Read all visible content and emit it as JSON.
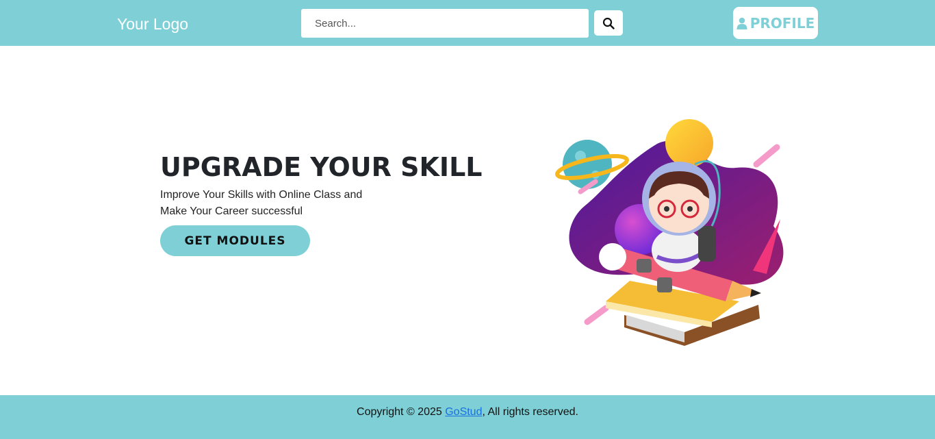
{
  "header": {
    "logo_text": "Your Logo",
    "search_placeholder": "Search...",
    "profile_label": "PROFILE"
  },
  "hero": {
    "title": "UPGRADE YOUR SKILL",
    "subtitle_line1": "Improve Your Skills with Online Class and",
    "subtitle_line2": "Make Your Career successful",
    "cta_label": "GET MODULES"
  },
  "footer": {
    "prefix": "Copyright © 2025 ",
    "link_text": "GoStud",
    "suffix": ", All rights reserved."
  },
  "colors": {
    "accent": "#7ed0d6",
    "link": "#1a6fe0",
    "heading": "#212529"
  },
  "icons": {
    "search": "search-icon",
    "profile": "user-icon",
    "illustration": "astronaut-reading-illustration"
  }
}
